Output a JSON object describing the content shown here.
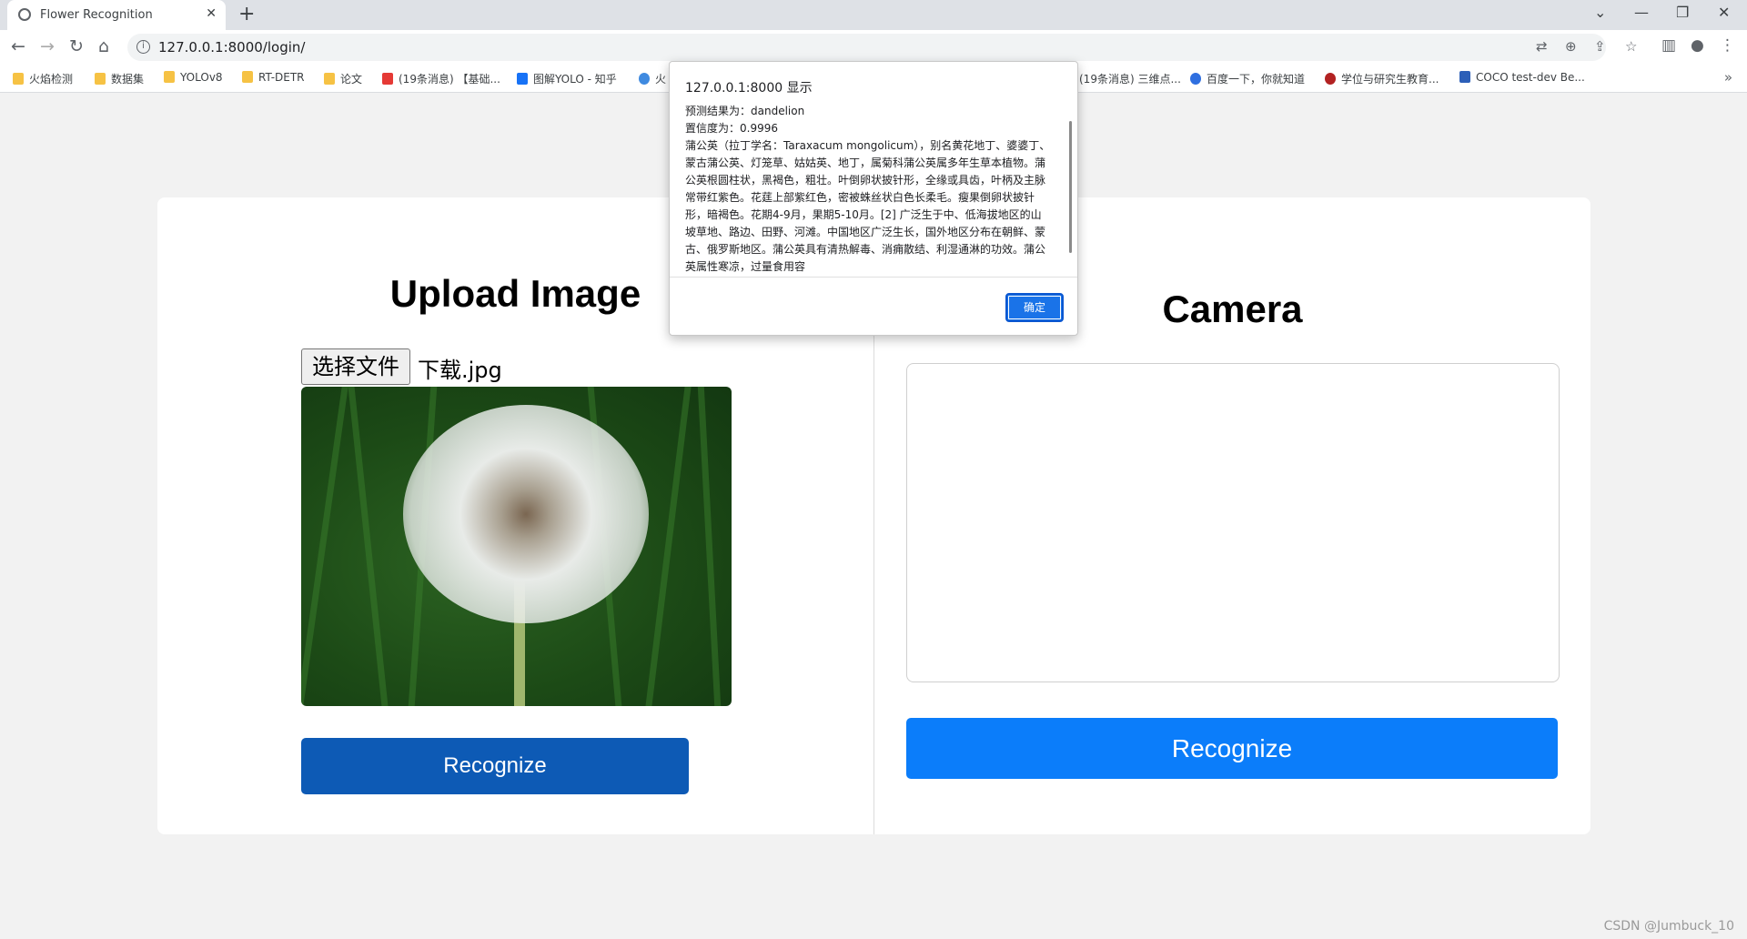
{
  "browser": {
    "tab_title": "Flower Recognition",
    "tab_close": "✕",
    "new_tab": "+",
    "url": "127.0.0.1:8000/login/",
    "window_controls": [
      "⌄",
      "—",
      "❐",
      "✕"
    ],
    "bookmarks": [
      {
        "label": "火焰检测",
        "icon": "folder-icon"
      },
      {
        "label": "数据集",
        "icon": "folder-icon"
      },
      {
        "label": "YOLOv8",
        "icon": "folder-icon"
      },
      {
        "label": "RT-DETR",
        "icon": "folder-icon"
      },
      {
        "label": "论文",
        "icon": "folder-icon"
      },
      {
        "label": "(19条消息) 【基础...",
        "icon": "csdn-icon"
      },
      {
        "label": "图解YOLO - 知乎",
        "icon": "zhihu-icon"
      },
      {
        "label": "火",
        "icon": "link-icon"
      },
      {
        "label": "(19条消息) 三维点...",
        "icon": "none"
      },
      {
        "label": "百度一下，你就知道",
        "icon": "baidu-icon"
      },
      {
        "label": "学位与研究生教育...",
        "icon": "university-icon"
      },
      {
        "label": "COCO test-dev Be...",
        "icon": "chart-icon"
      }
    ],
    "bookmarks_more": "»"
  },
  "upload": {
    "title": "Upload Image",
    "file_button": "选择文件",
    "file_name": "下载.jpg",
    "preview_alt": "dandelion",
    "recognize_label": "Recognize"
  },
  "camera": {
    "title": "Camera",
    "recognize_label": "Recognize"
  },
  "dialog": {
    "title": "127.0.0.1:8000 显示",
    "lines": [
      "预测结果为：dandelion",
      "置信度为：0.9996",
      "蒲公英（拉丁学名：Taraxacum mongolicum），别名黄花地丁、婆婆丁、蒙古蒲公英、灯笼草、姑姑英、地丁，属菊科蒲公英属多年生草本植物。蒲公英根圆柱状，黑褐色，粗壮。叶倒卵状披针形，全缘或具齿，叶柄及主脉常带红紫色。花莛上部紫红色，密被蛛丝状白色长柔毛。瘦果倒卵状披针形，暗褐色。花期4-9月，果期5-10月。[2] 广泛生于中、低海拔地区的山坡草地、路边、田野、河滩。中国地区广泛生长，国外地区分布在朝鲜、蒙古、俄罗斯地区。蒲公英具有清热解毒、消痈散结、利湿通淋的功效。蒲公英属性寒凉，过量食用容"
    ],
    "ok_label": "确定"
  },
  "watermark": "CSDN @Jumbuck_10"
}
